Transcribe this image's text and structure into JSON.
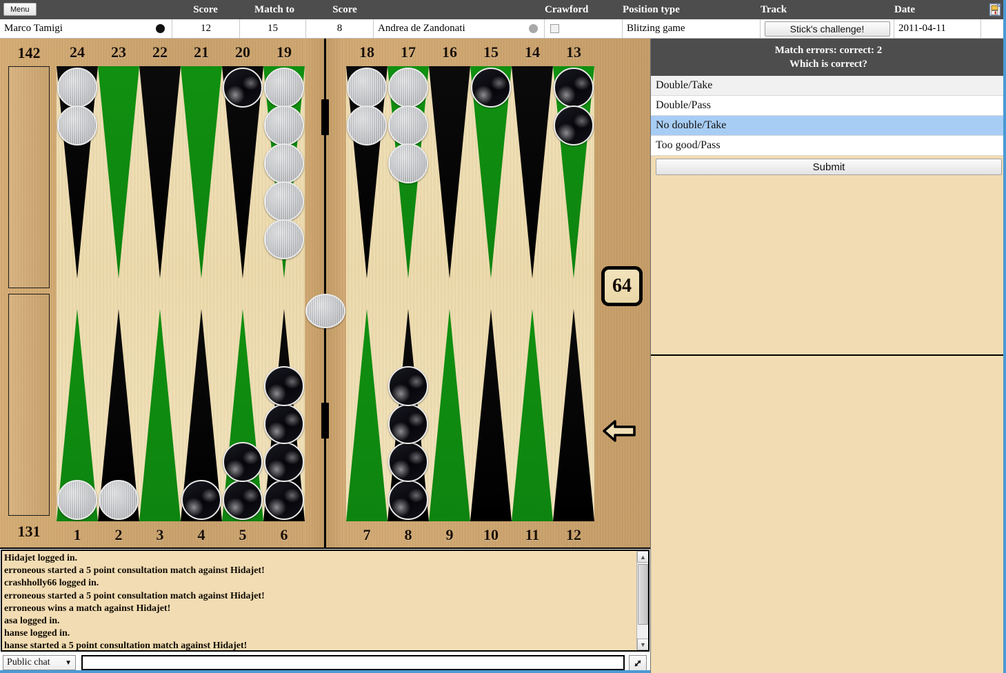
{
  "header": {
    "menu_label": "Menu",
    "save_icon": "save-document-icon",
    "columns": [
      {
        "label": "",
        "key": "player1"
      },
      {
        "label": "Score",
        "key": "score1"
      },
      {
        "label": "Match to",
        "key": "matchto"
      },
      {
        "label": "Score",
        "key": "score2"
      },
      {
        "label": "",
        "key": "player2"
      },
      {
        "label": "Crawford",
        "key": "crawford"
      },
      {
        "label": "Position type",
        "key": "postype"
      },
      {
        "label": "Track",
        "key": "track"
      },
      {
        "label": "Date",
        "key": "date"
      }
    ],
    "player1_name": "Marco Tamigi",
    "player1_turn_icon": "black-turn-dot",
    "score1": "12",
    "match_to": "15",
    "score2": "8",
    "player2_name": "Andrea de Zandonati",
    "player2_turn_icon": "grey-turn-dot",
    "crawford_checked": false,
    "position_type": "Blitzing game",
    "track_button": "Stick's challenge!",
    "date": "2011-04-11"
  },
  "board": {
    "pip_top": "142",
    "pip_bottom": "131",
    "cube_value": "64",
    "turn_arrow": "left-arrow-icon",
    "top_numbers": [
      "24",
      "23",
      "22",
      "21",
      "20",
      "19",
      "18",
      "17",
      "16",
      "15",
      "14",
      "13"
    ],
    "bottom_numbers": [
      "1",
      "2",
      "3",
      "4",
      "5",
      "6",
      "7",
      "8",
      "9",
      "10",
      "11",
      "12"
    ],
    "point_colors_top": [
      "black",
      "green",
      "black",
      "green",
      "black",
      "green",
      "black",
      "green",
      "black",
      "green",
      "black",
      "green"
    ],
    "point_colors_bottom": [
      "green",
      "black",
      "green",
      "black",
      "green",
      "black",
      "green",
      "black",
      "green",
      "black",
      "green",
      "black"
    ],
    "checkers": {
      "24": {
        "color": "white",
        "count": 2
      },
      "23": {
        "color": "none",
        "count": 0
      },
      "22": {
        "color": "none",
        "count": 0
      },
      "21": {
        "color": "none",
        "count": 0
      },
      "20": {
        "color": "black",
        "count": 1
      },
      "19": {
        "color": "white",
        "count": 5
      },
      "18": {
        "color": "white",
        "count": 2
      },
      "17": {
        "color": "white",
        "count": 3
      },
      "16": {
        "color": "none",
        "count": 0
      },
      "15": {
        "color": "black",
        "count": 1
      },
      "14": {
        "color": "none",
        "count": 0
      },
      "13": {
        "color": "black",
        "count": 2
      },
      "12": {
        "color": "none",
        "count": 0
      },
      "11": {
        "color": "none",
        "count": 0
      },
      "10": {
        "color": "none",
        "count": 0
      },
      "9": {
        "color": "none",
        "count": 0
      },
      "8": {
        "color": "black",
        "count": 4
      },
      "7": {
        "color": "none",
        "count": 0
      },
      "6": {
        "color": "black",
        "count": 4
      },
      "5": {
        "color": "black",
        "count": 2
      },
      "4": {
        "color": "black",
        "count": 1
      },
      "3": {
        "color": "none",
        "count": 0
      },
      "2": {
        "color": "white",
        "count": 1
      },
      "1": {
        "color": "white",
        "count": 1
      }
    },
    "bar": {
      "white": 1,
      "black": 0
    },
    "bearoff_top": 0,
    "bearoff_bottom": 0,
    "colors": {
      "point_green": "#109010",
      "point_black": "#000000",
      "frame_wood": "#c8a06a",
      "felt_wood": "#eeddb0"
    }
  },
  "quiz": {
    "errors_line": "Match errors: correct: 2",
    "question": "Which is correct?",
    "options": [
      {
        "label": "Double/Take",
        "selected": false
      },
      {
        "label": "Double/Pass",
        "selected": false
      },
      {
        "label": "No double/Take",
        "selected": true
      },
      {
        "label": "Too good/Pass",
        "selected": false
      }
    ],
    "submit_label": "Submit",
    "selected_color": "#a8cdf5"
  },
  "chat": {
    "lines": [
      "Hidajet logged in.",
      "erroneous started a 5 point consultation match against Hidajet!",
      "crashholly66 logged in.",
      "erroneous started a 5 point consultation match against Hidajet!",
      "erroneous wins a match against Hidajet!",
      "asa logged in.",
      "hanse logged in.",
      "hanse started a 5 point consultation match against Hidajet!"
    ],
    "channel": "Public chat",
    "channel_caret": "▼",
    "input_value": "",
    "input_placeholder": "",
    "expand_icon": "expand-arrow-icon",
    "scroll_up_icon": "▲",
    "scroll_down_icon": "▼"
  }
}
